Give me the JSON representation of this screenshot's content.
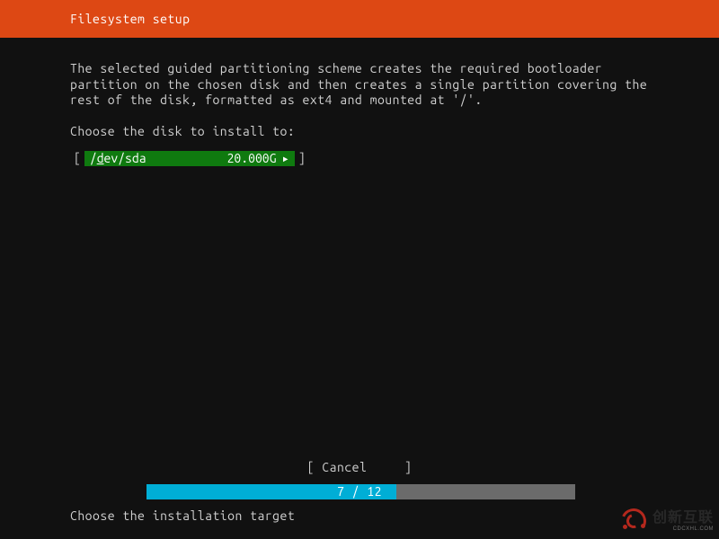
{
  "header": {
    "title": "Filesystem setup"
  },
  "description": {
    "line1": "The selected guided partitioning scheme creates the required bootloader partition on the chosen disk and then creates a single partition covering the rest of the disk, formatted as ext4 and mounted at '/'."
  },
  "prompt": "Choose the disk to install to:",
  "disk": {
    "bracket_open": "[",
    "dev_prefix": "/",
    "dev_underline_char": "d",
    "dev_rest": "ev/sda",
    "size": "20.000G",
    "chevron": "▸",
    "bracket_close": "]"
  },
  "cancel": {
    "bracket_open": "[",
    "label": "Cancel",
    "bracket_close": "]"
  },
  "progress": {
    "current": 7,
    "total": 12,
    "text": "7 / 12"
  },
  "footer_prompt": "Choose the installation target",
  "watermark": {
    "main": "创新互联",
    "sub": "CDCXHL.COM"
  }
}
